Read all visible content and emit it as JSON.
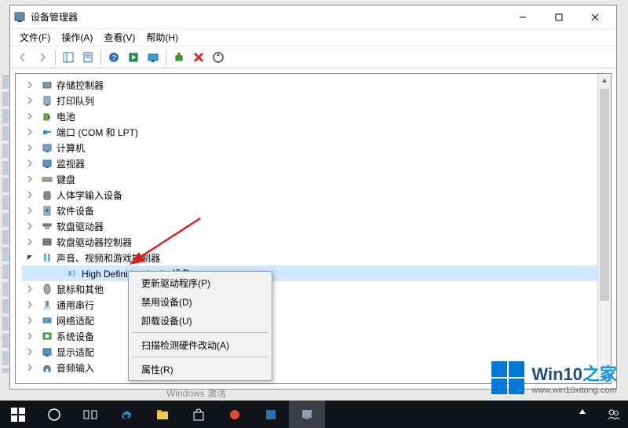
{
  "window": {
    "title": "设备管理器"
  },
  "menu": {
    "file": "文件(F)",
    "action": "操作(A)",
    "view": "查看(V)",
    "help": "帮助(H)"
  },
  "tree": {
    "items": [
      {
        "label": "存储控制器"
      },
      {
        "label": "打印队列"
      },
      {
        "label": "电池"
      },
      {
        "label": "端口 (COM 和 LPT)"
      },
      {
        "label": "计算机"
      },
      {
        "label": "监视器"
      },
      {
        "label": "键盘"
      },
      {
        "label": "人体学输入设备"
      },
      {
        "label": "软件设备"
      },
      {
        "label": "软盘驱动器"
      },
      {
        "label": "软盘驱动器控制器"
      },
      {
        "label": "声音、视频和游戏控制器",
        "expanded": true,
        "children": [
          {
            "label": "High Definition Audio 设备",
            "selected": true
          }
        ]
      },
      {
        "label": "鼠标和其他"
      },
      {
        "label": "通用串行"
      },
      {
        "label": "网络适配"
      },
      {
        "label": "系统设备"
      },
      {
        "label": "显示适配"
      },
      {
        "label": "音频输入"
      }
    ]
  },
  "context_menu": {
    "update": "更新驱动程序(P)",
    "disable": "禁用设备(D)",
    "uninstall": "卸载设备(U)",
    "scan": "扫描检测硬件改动(A)",
    "properties": "属性(R)"
  },
  "activation": "Windows 激活",
  "watermark": {
    "brand_a": "Win10",
    "brand_b": "之家",
    "url": "www.win10xitong.com"
  }
}
